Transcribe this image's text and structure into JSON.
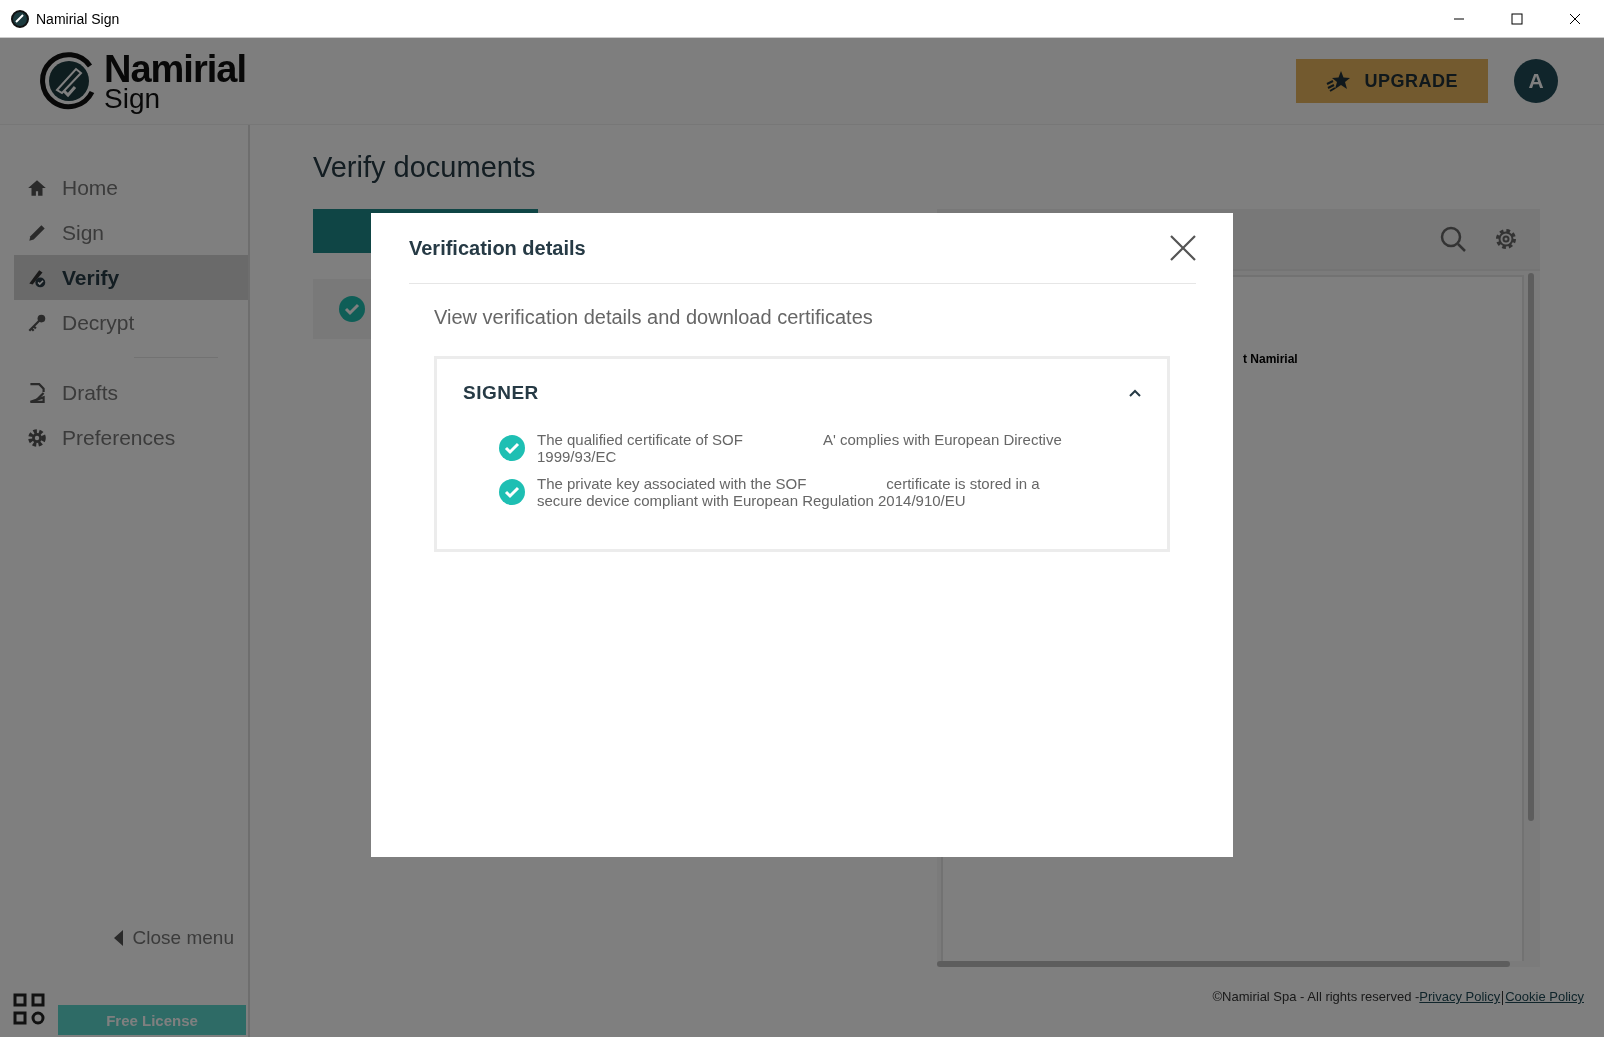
{
  "window": {
    "title": "Namirial Sign"
  },
  "header": {
    "logo_brand": "Namirial",
    "logo_product": "Sign",
    "upgrade_button": "UPGRADE",
    "avatar": "A"
  },
  "sidebar": {
    "main_items": [
      {
        "label": "Home",
        "selected": false
      },
      {
        "label": "Sign",
        "selected": false
      },
      {
        "label": "Verify",
        "selected": true
      },
      {
        "label": "Decrypt",
        "selected": false
      }
    ],
    "secondary_items": [
      {
        "label": "Drafts",
        "selected": false
      },
      {
        "label": "Preferences",
        "selected": false
      }
    ],
    "close_menu": "Close menu",
    "license": "Free License"
  },
  "main": {
    "title": "Verify documents",
    "preview_text": "t Namirial"
  },
  "footer": {
    "copyright": "©Namirial Spa - All rights reserved -",
    "links": [
      "Privacy Policy",
      "Cookie Policy"
    ]
  },
  "modal": {
    "title": "Verification details",
    "subtitle": "View verification details and download certificates",
    "section": {
      "title": "SIGNER",
      "expanded": true,
      "checks": [
        {
          "text_before": "The qualified certificate of SOF",
          "text_after": "A' complies with European Directive 1999/93/EC"
        },
        {
          "text_before": "The private key associated with the SOF",
          "text_after": "certificate is stored in a secure device compliant with European Regulation 2014/910/EU"
        }
      ]
    }
  }
}
